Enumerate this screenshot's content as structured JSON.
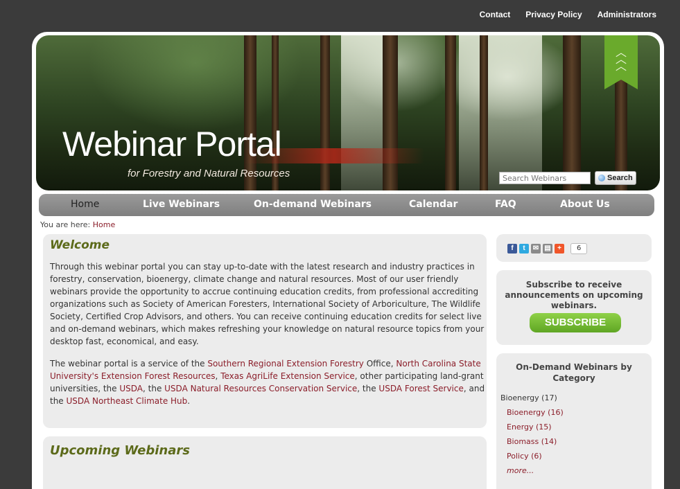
{
  "top_links": [
    "Contact",
    "Privacy Policy",
    "Administrators"
  ],
  "banner": {
    "title": "Webinar Portal",
    "subtitle": "for Forestry and Natural Resources",
    "search_placeholder": "Search Webinars",
    "search_button": "Search"
  },
  "nav": [
    "Home",
    "Live Webinars",
    "On-demand Webinars",
    "Calendar",
    "FAQ",
    "About Us"
  ],
  "breadcrumb": {
    "prefix": "You are here:",
    "current": "Home"
  },
  "welcome": {
    "heading": "Welcome",
    "p1": "Through this webinar portal you can stay up-to-date with the latest research and industry practices in forestry, conservation, bioenergy, climate change and natural resources. Most of our user friendly webinars provide the opportunity to accrue continuing education credits, from professional accrediting organizations such as Society of American Foresters, International Society of Arboriculture, The Wildlife Society, Certified Crop Advisors, and others. You can receive continuing education credits for select live and on-demand webinars, which makes refreshing your knowledge on natural resource topics from your desktop fast, economical, and easy.",
    "p2": [
      {
        "t": "The webinar portal is a service of the ",
        "link": false
      },
      {
        "t": "Southern Regional Extension Forestry",
        "link": true
      },
      {
        "t": " Office, ",
        "link": false
      },
      {
        "t": "North Carolina State University's Extension Forest Resources",
        "link": true
      },
      {
        "t": ", ",
        "link": false
      },
      {
        "t": "Texas AgriLife Extension Service",
        "link": true
      },
      {
        "t": ", other participating land-grant universities, the ",
        "link": false
      },
      {
        "t": "USDA",
        "link": true
      },
      {
        "t": ", the ",
        "link": false
      },
      {
        "t": "USDA Natural Resources Conservation Service",
        "link": true
      },
      {
        "t": ", the ",
        "link": false
      },
      {
        "t": "USDA Forest Service",
        "link": true
      },
      {
        "t": ", and the ",
        "link": false
      },
      {
        "t": "USDA Northeast Climate Hub",
        "link": true
      },
      {
        "t": ".",
        "link": false
      }
    ]
  },
  "upcoming": {
    "heading": "Upcoming Webinars"
  },
  "social": {
    "count": "6"
  },
  "subscribe": {
    "text": "Subscribe to receive announcements on upcoming webinars.",
    "button": "SUBSCRIBE"
  },
  "categories": {
    "heading": "On-Demand Webinars by Category",
    "parent": "Bioenergy (17)",
    "items": [
      "Bioenergy (16)",
      "Energy (15)",
      "Biomass (14)",
      "Policy (6)"
    ],
    "more": "more..."
  },
  "colors": {
    "link": "#8b1e2a",
    "heading": "#5c6a1a",
    "subscribe": "#6fb52d"
  }
}
